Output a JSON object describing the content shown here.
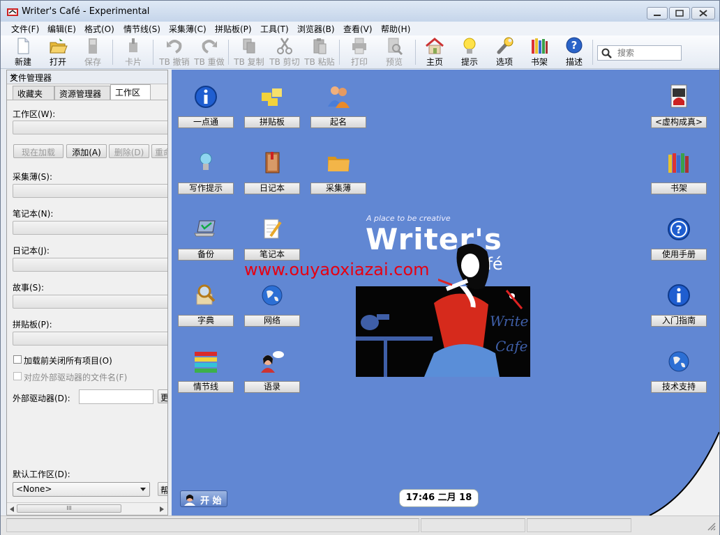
{
  "window": {
    "title": "Writer's Café - Experimental"
  },
  "menu": [
    "文件(F)",
    "编辑(E)",
    "格式(O)",
    "情节线(S)",
    "采集薄(C)",
    "拼贴板(P)",
    "工具(T)",
    "浏览器(B)",
    "查看(V)",
    "帮助(H)"
  ],
  "toolbar": {
    "new": "新建",
    "open": "打开",
    "save": "保存",
    "card": "卡片",
    "undo": "TB 撤销",
    "redo": "TB 重做",
    "copy": "TB 复制",
    "cut": "TB 剪切",
    "paste": "TB 粘贴",
    "print": "打印",
    "preview": "预览",
    "home": "主页",
    "tips": "提示",
    "options": "选项",
    "bookshelf": "书架",
    "describe": "描述"
  },
  "search": {
    "placeholder": "搜索"
  },
  "panel": {
    "title": "文件管理器",
    "close": "×",
    "tabs": [
      "收藏夹",
      "资源管理器",
      "工作区"
    ],
    "workspace_label": "工作区(W):",
    "buttons": {
      "load_now": "现在加载",
      "add": "添加(A)",
      "delete": "删除(D)",
      "rename": "重命"
    },
    "collections_label": "采集薄(S):",
    "notebooks_label": "笔记本(N):",
    "journals_label": "日记本(J):",
    "stories_label": "故事(S):",
    "pinboards_label": "拼贴板(P):",
    "close_all_label": "加载前关闭所有项目(O)",
    "external_map_label": "对应外部驱动器的文件名(F)",
    "external_drive_label": "外部驱动器(D):",
    "external_drive_button": "更",
    "default_workspace_label": "默认工作区(D):",
    "default_workspace_value": "<None>",
    "default_workspace_button": "帮",
    "scroll_grip": "III"
  },
  "desktop": {
    "icons_left": [
      "一点通",
      "拼贴板",
      "起名",
      "写作提示",
      "日记本",
      "采集薄",
      "备份",
      "笔记本",
      "字典",
      "网络",
      "情节线",
      "语录"
    ],
    "icons_right": [
      "<虚构成真>",
      "书架",
      "使用手册",
      "入门指南",
      "技术支持"
    ],
    "start": "开 始",
    "clock": "17:46 二月 18",
    "logo_tagline": "A place to be creative",
    "logo_title": "Writer's",
    "logo_subtitle": "Café",
    "scene_text_1": "Write",
    "scene_text_2": "Cafe"
  },
  "watermark": "www.ouyaoxiazai.com",
  "colors": {
    "desktop": "#6187d3",
    "titlebar": "#c5d5ea",
    "watermark": "#e60012"
  }
}
